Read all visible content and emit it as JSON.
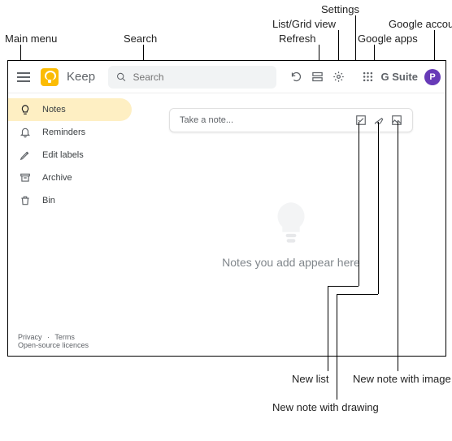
{
  "callouts": {
    "main_menu": "Main menu",
    "search": "Search",
    "refresh": "Refresh",
    "list_grid": "List/Grid view",
    "settings": "Settings",
    "google_apps": "Google apps",
    "google_account": "Google account",
    "new_list": "New list",
    "new_drawing": "New note with drawing",
    "new_image": "New note with image"
  },
  "topbar": {
    "app_name": "Keep",
    "search_placeholder": "Search",
    "gsuite_label": "G Suite",
    "avatar_initial": "P"
  },
  "sidebar": {
    "items": [
      {
        "label": "Notes",
        "icon": "bulb",
        "active": true
      },
      {
        "label": "Reminders",
        "icon": "bell",
        "active": false
      },
      {
        "label": "Edit labels",
        "icon": "pencil",
        "active": false
      },
      {
        "label": "Archive",
        "icon": "archive",
        "active": false
      },
      {
        "label": "Bin",
        "icon": "trash",
        "active": false
      }
    ]
  },
  "note_input": {
    "placeholder": "Take a note..."
  },
  "empty_state": {
    "message": "Notes you add appear here"
  },
  "footer": {
    "privacy": "Privacy",
    "terms": "Terms",
    "open_source": "Open-source licences"
  }
}
